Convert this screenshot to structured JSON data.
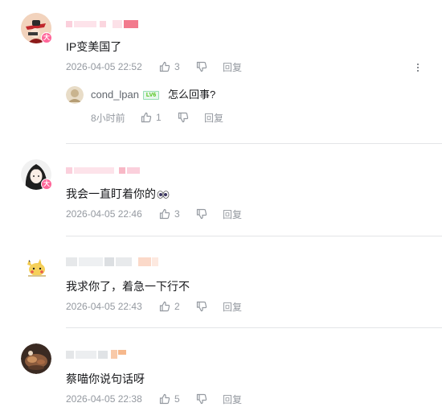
{
  "comments": [
    {
      "avatar": "avatar-red-hat",
      "badge": "大",
      "text": "IP变美国了",
      "time": "2026-04-05 22:52",
      "likes": "3",
      "reply_label": "回复",
      "reply": {
        "username": "cond_lpan",
        "level": "LV6",
        "text": "怎么回事?",
        "time": "8小时前",
        "likes": "1",
        "reply_label": "回复"
      }
    },
    {
      "avatar": "avatar-anime-girl",
      "badge": "大",
      "text": "我会一直盯着你的",
      "emoji": "eyes-emoji",
      "time": "2026-04-05 22:46",
      "likes": "3",
      "reply_label": "回复"
    },
    {
      "avatar": "avatar-pikachu",
      "text": "我求你了，着急一下行不",
      "time": "2026-04-05 22:43",
      "likes": "2",
      "reply_label": "回复"
    },
    {
      "avatar": "avatar-dark-photo",
      "text": "蔡喵你说句话呀",
      "time": "2026-04-05 22:38",
      "likes": "5",
      "reply_label": "回复"
    }
  ],
  "colors": {
    "badge": "#ff6699",
    "meta": "#9499a0",
    "divider": "#e3e5e7",
    "level": "#52c41a"
  }
}
